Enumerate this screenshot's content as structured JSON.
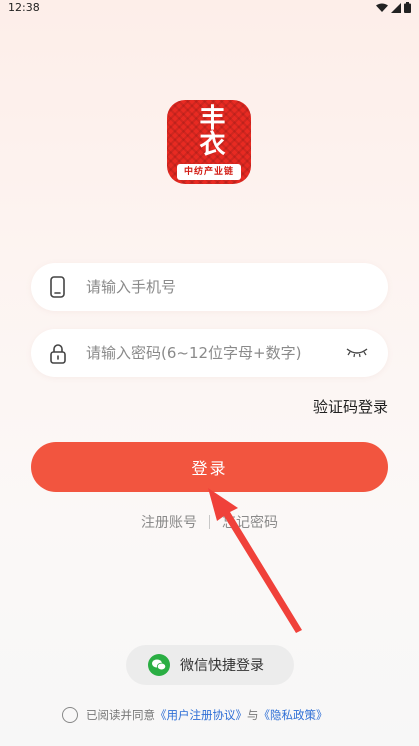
{
  "status_bar": {
    "time": "12:38"
  },
  "logo": {
    "top_text": "丰衣",
    "band_text": "中纺产业链"
  },
  "phone_field": {
    "placeholder": "请输入手机号",
    "value": ""
  },
  "password_field": {
    "placeholder": "请输入密码(6~12位字母+数字)",
    "value": ""
  },
  "sms_login_label": "验证码登录",
  "login_button_label": "登录",
  "links": {
    "register": "注册账号",
    "forgot": "忘记密码"
  },
  "wechat_login_label": "微信快捷登录",
  "agreement": {
    "prefix": "已阅读并同意",
    "user_agreement": "《用户注册协议》",
    "and": "与",
    "privacy_policy": "《隐私政策》"
  },
  "colors": {
    "accent": "#f2553f",
    "link": "#2f6fd6",
    "wechat": "#2aae43",
    "logo_red": "#e82a22"
  }
}
